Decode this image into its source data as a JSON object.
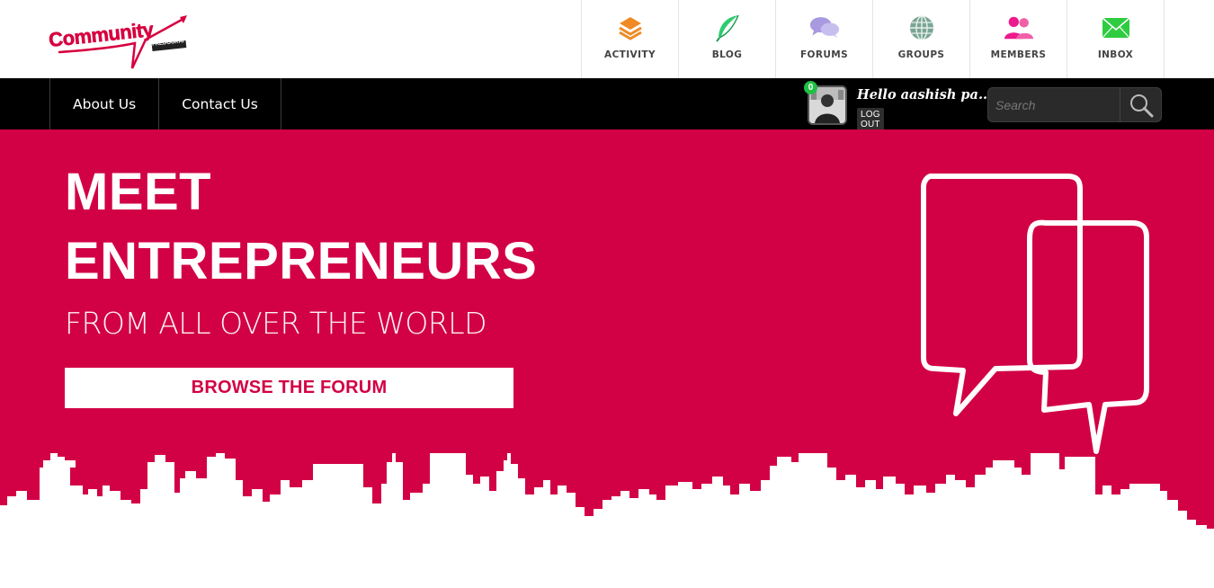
{
  "logo": {
    "text": "Community",
    "sub": "FREDOURAI"
  },
  "icon_nav": [
    {
      "label": "ACTIVITY",
      "icon": "layers-icon",
      "color": "#f08a24"
    },
    {
      "label": "BLOG",
      "icon": "feather-icon",
      "color": "#2ecc71"
    },
    {
      "label": "FORUMS",
      "icon": "chat-bubbles-icon",
      "color": "#a99ae0"
    },
    {
      "label": "GROUPS",
      "icon": "globe-icon",
      "color": "#6a9a8a"
    },
    {
      "label": "MEMBERS",
      "icon": "users-icon",
      "color": "#ec1a8c"
    },
    {
      "label": "INBOX",
      "icon": "envelope-icon",
      "color": "#2ecc40"
    }
  ],
  "menu": [
    {
      "label": "About Us"
    },
    {
      "label": "Contact Us"
    }
  ],
  "user": {
    "greeting": "Hello aashish pa...",
    "logout": "LOG OUT",
    "notifications": "0"
  },
  "search": {
    "placeholder": "Search"
  },
  "hero": {
    "line1": "MEET",
    "line2": "ENTREPRENEURS",
    "subtitle": "FROM ALL OVER THE WORLD",
    "cta": "BROWSE THE FORUM",
    "accent": "#d20045"
  }
}
